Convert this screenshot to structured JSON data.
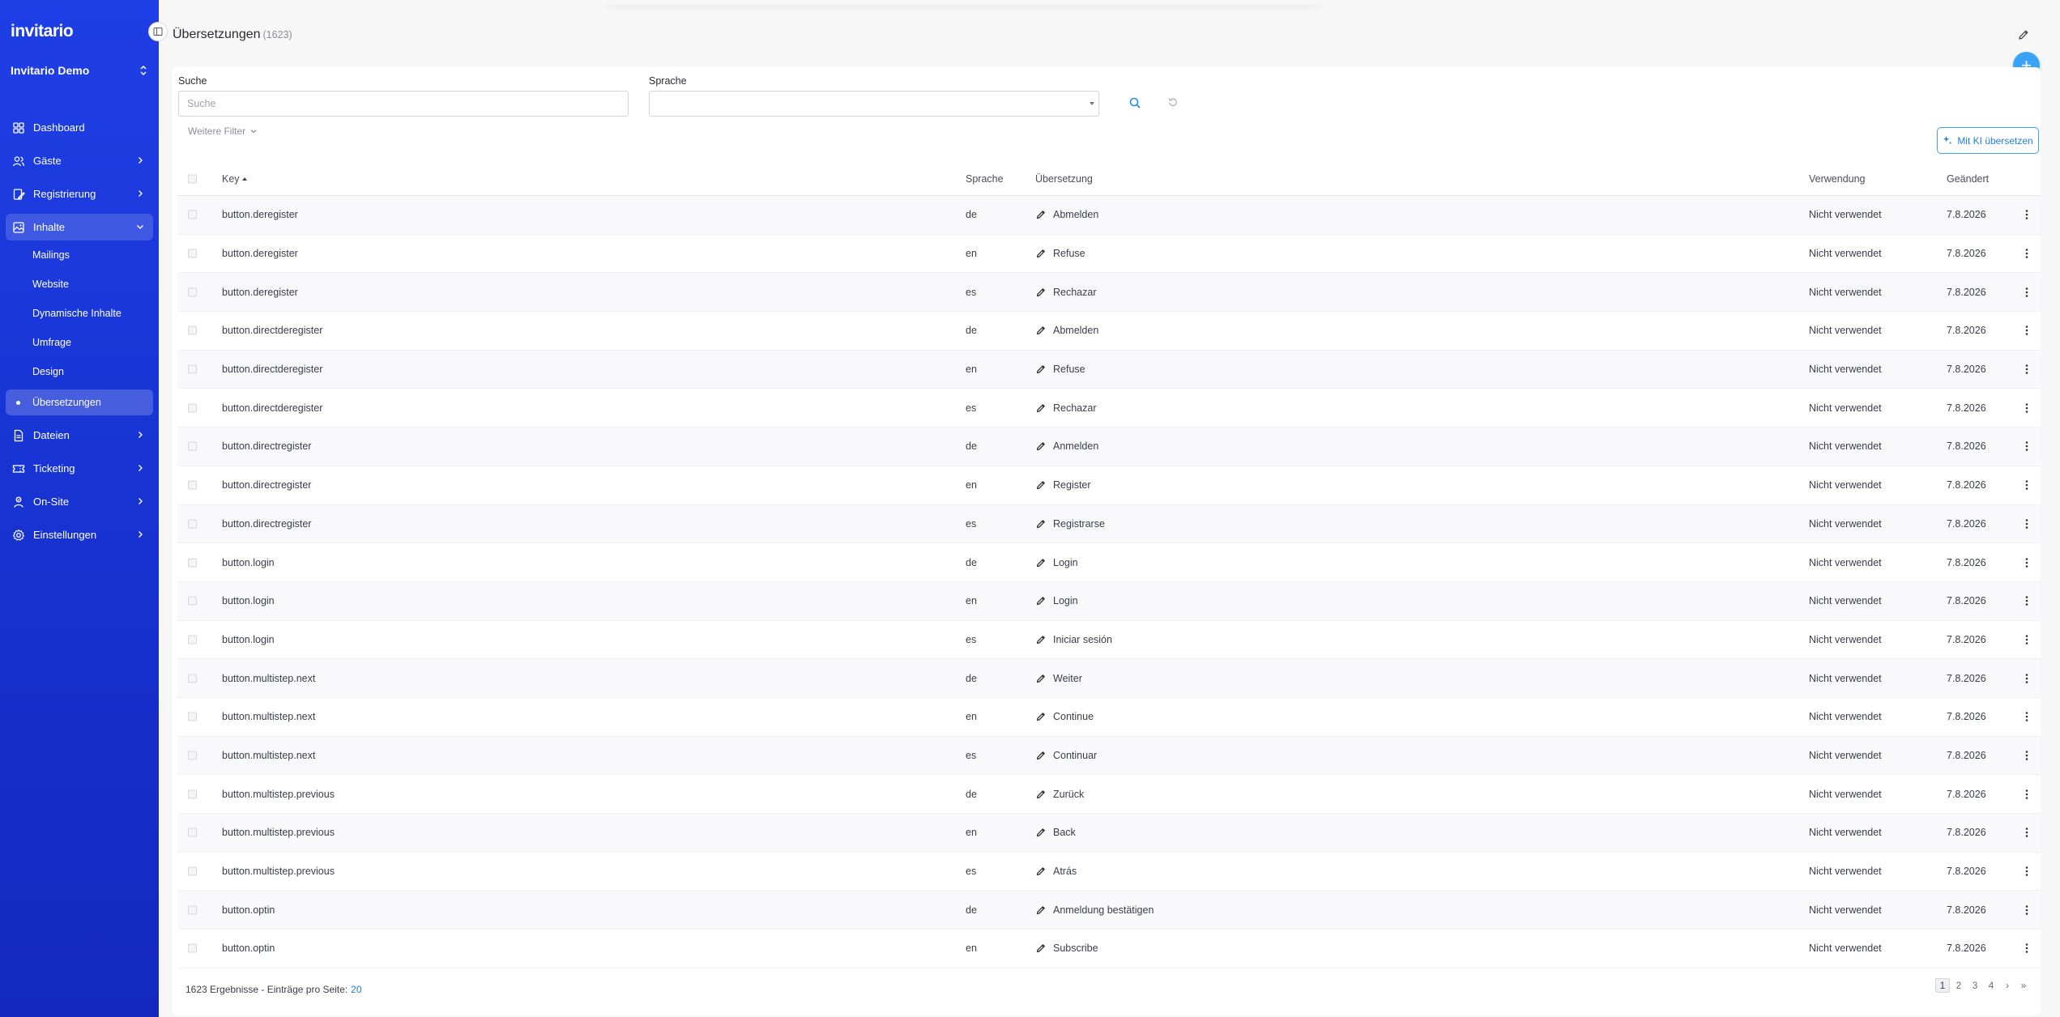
{
  "app": {
    "logo": "invitario",
    "org_name": "Invitario Demo"
  },
  "sidebar": {
    "items": [
      {
        "id": "dashboard",
        "label": "Dashboard",
        "icon": "dashboard-icon",
        "chevron": false
      },
      {
        "id": "gaeste",
        "label": "Gäste",
        "icon": "users-icon",
        "chevron": true
      },
      {
        "id": "registrierung",
        "label": "Registrierung",
        "icon": "registration-icon",
        "chevron": true
      },
      {
        "id": "inhalte",
        "label": "Inhalte",
        "icon": "content-icon",
        "chevron": true,
        "open": true
      }
    ],
    "sub_items": [
      {
        "id": "mailings",
        "label": "Mailings"
      },
      {
        "id": "website",
        "label": "Website"
      },
      {
        "id": "dynamische-inhalte",
        "label": "Dynamische Inhalte"
      },
      {
        "id": "umfrage",
        "label": "Umfrage"
      },
      {
        "id": "design",
        "label": "Design"
      },
      {
        "id": "uebersetzungen",
        "label": "Übersetzungen",
        "active": true
      }
    ],
    "items_after": [
      {
        "id": "dateien",
        "label": "Dateien",
        "icon": "files-icon"
      },
      {
        "id": "ticketing",
        "label": "Ticketing",
        "icon": "ticket-icon"
      },
      {
        "id": "on-site",
        "label": "On-Site",
        "icon": "onsite-icon"
      },
      {
        "id": "einstellungen",
        "label": "Einstellungen",
        "icon": "settings-icon"
      }
    ]
  },
  "header": {
    "title": "Übersetzungen",
    "count": "(1623)"
  },
  "filters": {
    "search_label": "Suche",
    "search_placeholder": "Suche",
    "language_label": "Sprache",
    "more_filters": "Weitere Filter",
    "ai_button": "Mit KI übersetzen"
  },
  "table": {
    "columns": {
      "key": "Key",
      "language": "Sprache",
      "translation": "Übersetzung",
      "usage": "Verwendung",
      "changed": "Geändert"
    },
    "rows": [
      {
        "key": "button.deregister",
        "lang": "de",
        "translation": "Abmelden",
        "usage": "Nicht verwendet",
        "changed": "7.8.2026"
      },
      {
        "key": "button.deregister",
        "lang": "en",
        "translation": "Refuse",
        "usage": "Nicht verwendet",
        "changed": "7.8.2026"
      },
      {
        "key": "button.deregister",
        "lang": "es",
        "translation": "Rechazar",
        "usage": "Nicht verwendet",
        "changed": "7.8.2026"
      },
      {
        "key": "button.directderegister",
        "lang": "de",
        "translation": "Abmelden",
        "usage": "Nicht verwendet",
        "changed": "7.8.2026"
      },
      {
        "key": "button.directderegister",
        "lang": "en",
        "translation": "Refuse",
        "usage": "Nicht verwendet",
        "changed": "7.8.2026"
      },
      {
        "key": "button.directderegister",
        "lang": "es",
        "translation": "Rechazar",
        "usage": "Nicht verwendet",
        "changed": "7.8.2026"
      },
      {
        "key": "button.directregister",
        "lang": "de",
        "translation": "Anmelden",
        "usage": "Nicht verwendet",
        "changed": "7.8.2026"
      },
      {
        "key": "button.directregister",
        "lang": "en",
        "translation": "Register",
        "usage": "Nicht verwendet",
        "changed": "7.8.2026"
      },
      {
        "key": "button.directregister",
        "lang": "es",
        "translation": "Registrarse",
        "usage": "Nicht verwendet",
        "changed": "7.8.2026"
      },
      {
        "key": "button.login",
        "lang": "de",
        "translation": "Login",
        "usage": "Nicht verwendet",
        "changed": "7.8.2026"
      },
      {
        "key": "button.login",
        "lang": "en",
        "translation": "Login",
        "usage": "Nicht verwendet",
        "changed": "7.8.2026"
      },
      {
        "key": "button.login",
        "lang": "es",
        "translation": "Iniciar sesión",
        "usage": "Nicht verwendet",
        "changed": "7.8.2026"
      },
      {
        "key": "button.multistep.next",
        "lang": "de",
        "translation": "Weiter",
        "usage": "Nicht verwendet",
        "changed": "7.8.2026"
      },
      {
        "key": "button.multistep.next",
        "lang": "en",
        "translation": "Continue",
        "usage": "Nicht verwendet",
        "changed": "7.8.2026"
      },
      {
        "key": "button.multistep.next",
        "lang": "es",
        "translation": "Continuar",
        "usage": "Nicht verwendet",
        "changed": "7.8.2026"
      },
      {
        "key": "button.multistep.previous",
        "lang": "de",
        "translation": "Zurück",
        "usage": "Nicht verwendet",
        "changed": "7.8.2026"
      },
      {
        "key": "button.multistep.previous",
        "lang": "en",
        "translation": "Back",
        "usage": "Nicht verwendet",
        "changed": "7.8.2026"
      },
      {
        "key": "button.multistep.previous",
        "lang": "es",
        "translation": "Atrás",
        "usage": "Nicht verwendet",
        "changed": "7.8.2026"
      },
      {
        "key": "button.optin",
        "lang": "de",
        "translation": "Anmeldung bestätigen",
        "usage": "Nicht verwendet",
        "changed": "7.8.2026"
      },
      {
        "key": "button.optin",
        "lang": "en",
        "translation": "Subscribe",
        "usage": "Nicht verwendet",
        "changed": "7.8.2026"
      }
    ]
  },
  "footer": {
    "results": "1623 Ergebnisse",
    "separator": " - ",
    "per_page_label": "Einträge pro Seite:",
    "per_page": "20"
  },
  "pagination": {
    "pages": [
      "1",
      "2",
      "3",
      "4"
    ],
    "current": "1",
    "next": "›",
    "last": "»"
  },
  "colors": {
    "sidebar": "#1f3fe6",
    "accent": "#3aa3f5",
    "link": "#1f7fd8"
  }
}
